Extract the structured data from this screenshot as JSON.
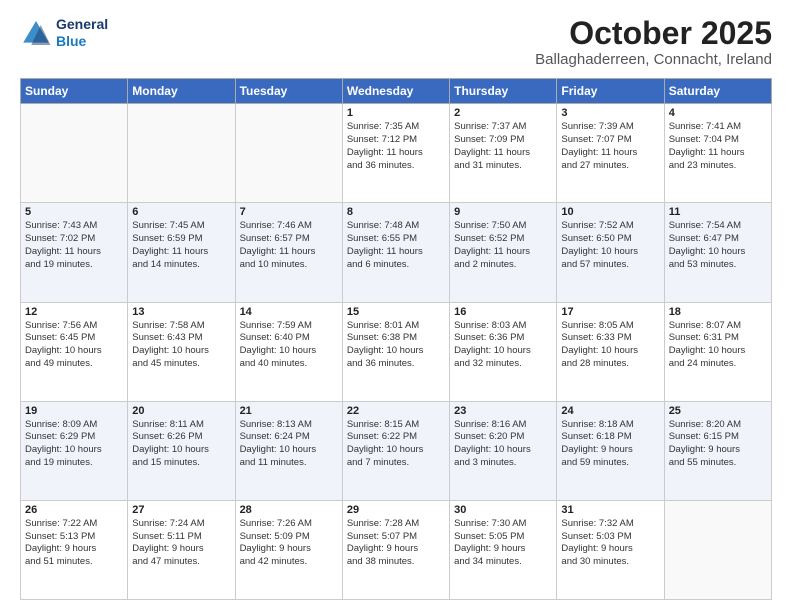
{
  "header": {
    "logo_line1": "General",
    "logo_line2": "Blue",
    "month": "October 2025",
    "location": "Ballaghaderreen, Connacht, Ireland"
  },
  "weekdays": [
    "Sunday",
    "Monday",
    "Tuesday",
    "Wednesday",
    "Thursday",
    "Friday",
    "Saturday"
  ],
  "weeks": [
    [
      {
        "day": "",
        "info": ""
      },
      {
        "day": "",
        "info": ""
      },
      {
        "day": "",
        "info": ""
      },
      {
        "day": "1",
        "info": "Sunrise: 7:35 AM\nSunset: 7:12 PM\nDaylight: 11 hours\nand 36 minutes."
      },
      {
        "day": "2",
        "info": "Sunrise: 7:37 AM\nSunset: 7:09 PM\nDaylight: 11 hours\nand 31 minutes."
      },
      {
        "day": "3",
        "info": "Sunrise: 7:39 AM\nSunset: 7:07 PM\nDaylight: 11 hours\nand 27 minutes."
      },
      {
        "day": "4",
        "info": "Sunrise: 7:41 AM\nSunset: 7:04 PM\nDaylight: 11 hours\nand 23 minutes."
      }
    ],
    [
      {
        "day": "5",
        "info": "Sunrise: 7:43 AM\nSunset: 7:02 PM\nDaylight: 11 hours\nand 19 minutes."
      },
      {
        "day": "6",
        "info": "Sunrise: 7:45 AM\nSunset: 6:59 PM\nDaylight: 11 hours\nand 14 minutes."
      },
      {
        "day": "7",
        "info": "Sunrise: 7:46 AM\nSunset: 6:57 PM\nDaylight: 11 hours\nand 10 minutes."
      },
      {
        "day": "8",
        "info": "Sunrise: 7:48 AM\nSunset: 6:55 PM\nDaylight: 11 hours\nand 6 minutes."
      },
      {
        "day": "9",
        "info": "Sunrise: 7:50 AM\nSunset: 6:52 PM\nDaylight: 11 hours\nand 2 minutes."
      },
      {
        "day": "10",
        "info": "Sunrise: 7:52 AM\nSunset: 6:50 PM\nDaylight: 10 hours\nand 57 minutes."
      },
      {
        "day": "11",
        "info": "Sunrise: 7:54 AM\nSunset: 6:47 PM\nDaylight: 10 hours\nand 53 minutes."
      }
    ],
    [
      {
        "day": "12",
        "info": "Sunrise: 7:56 AM\nSunset: 6:45 PM\nDaylight: 10 hours\nand 49 minutes."
      },
      {
        "day": "13",
        "info": "Sunrise: 7:58 AM\nSunset: 6:43 PM\nDaylight: 10 hours\nand 45 minutes."
      },
      {
        "day": "14",
        "info": "Sunrise: 7:59 AM\nSunset: 6:40 PM\nDaylight: 10 hours\nand 40 minutes."
      },
      {
        "day": "15",
        "info": "Sunrise: 8:01 AM\nSunset: 6:38 PM\nDaylight: 10 hours\nand 36 minutes."
      },
      {
        "day": "16",
        "info": "Sunrise: 8:03 AM\nSunset: 6:36 PM\nDaylight: 10 hours\nand 32 minutes."
      },
      {
        "day": "17",
        "info": "Sunrise: 8:05 AM\nSunset: 6:33 PM\nDaylight: 10 hours\nand 28 minutes."
      },
      {
        "day": "18",
        "info": "Sunrise: 8:07 AM\nSunset: 6:31 PM\nDaylight: 10 hours\nand 24 minutes."
      }
    ],
    [
      {
        "day": "19",
        "info": "Sunrise: 8:09 AM\nSunset: 6:29 PM\nDaylight: 10 hours\nand 19 minutes."
      },
      {
        "day": "20",
        "info": "Sunrise: 8:11 AM\nSunset: 6:26 PM\nDaylight: 10 hours\nand 15 minutes."
      },
      {
        "day": "21",
        "info": "Sunrise: 8:13 AM\nSunset: 6:24 PM\nDaylight: 10 hours\nand 11 minutes."
      },
      {
        "day": "22",
        "info": "Sunrise: 8:15 AM\nSunset: 6:22 PM\nDaylight: 10 hours\nand 7 minutes."
      },
      {
        "day": "23",
        "info": "Sunrise: 8:16 AM\nSunset: 6:20 PM\nDaylight: 10 hours\nand 3 minutes."
      },
      {
        "day": "24",
        "info": "Sunrise: 8:18 AM\nSunset: 6:18 PM\nDaylight: 9 hours\nand 59 minutes."
      },
      {
        "day": "25",
        "info": "Sunrise: 8:20 AM\nSunset: 6:15 PM\nDaylight: 9 hours\nand 55 minutes."
      }
    ],
    [
      {
        "day": "26",
        "info": "Sunrise: 7:22 AM\nSunset: 5:13 PM\nDaylight: 9 hours\nand 51 minutes."
      },
      {
        "day": "27",
        "info": "Sunrise: 7:24 AM\nSunset: 5:11 PM\nDaylight: 9 hours\nand 47 minutes."
      },
      {
        "day": "28",
        "info": "Sunrise: 7:26 AM\nSunset: 5:09 PM\nDaylight: 9 hours\nand 42 minutes."
      },
      {
        "day": "29",
        "info": "Sunrise: 7:28 AM\nSunset: 5:07 PM\nDaylight: 9 hours\nand 38 minutes."
      },
      {
        "day": "30",
        "info": "Sunrise: 7:30 AM\nSunset: 5:05 PM\nDaylight: 9 hours\nand 34 minutes."
      },
      {
        "day": "31",
        "info": "Sunrise: 7:32 AM\nSunset: 5:03 PM\nDaylight: 9 hours\nand 30 minutes."
      },
      {
        "day": "",
        "info": ""
      }
    ]
  ]
}
